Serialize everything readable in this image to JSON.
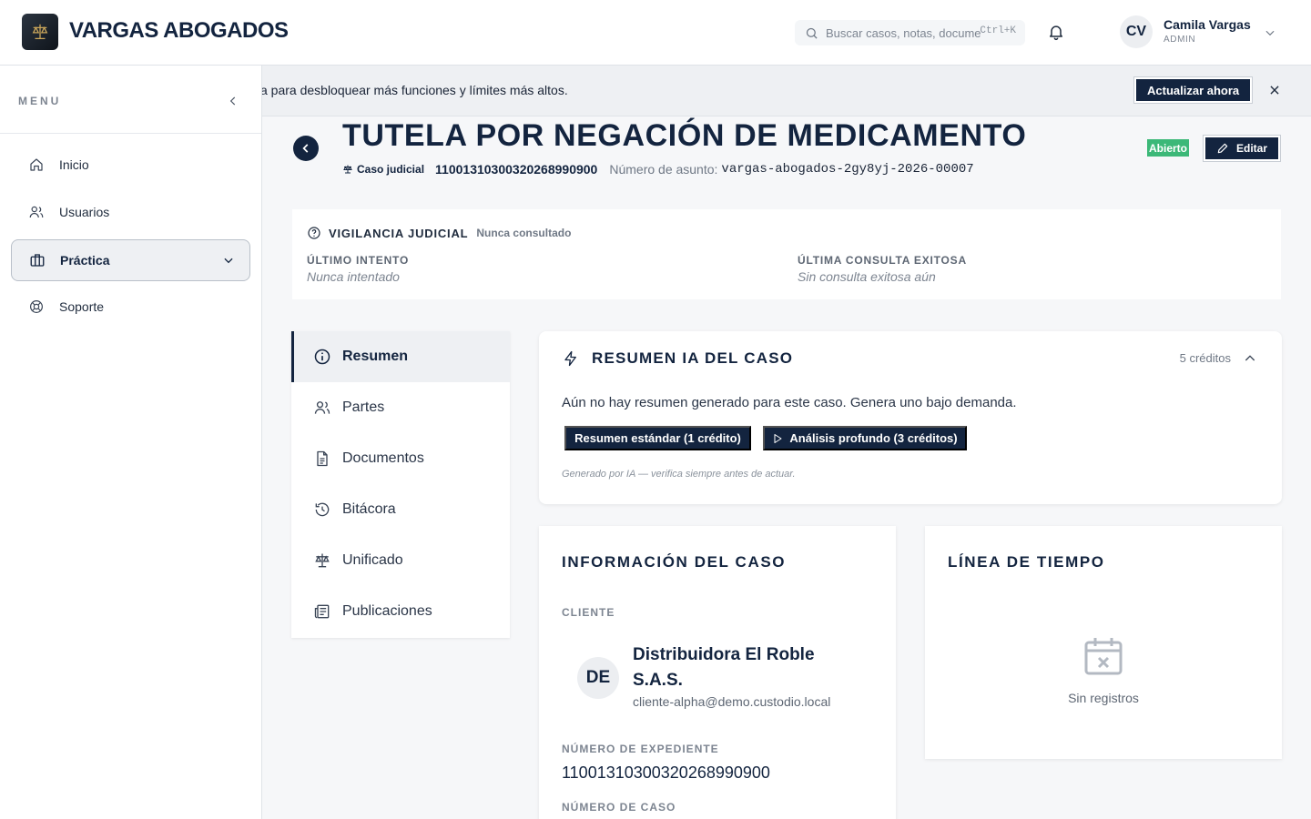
{
  "header": {
    "brand": "VARGAS ABOGADOS",
    "search_placeholder": "Buscar casos, notas, documentos",
    "search_shortcut": "Ctrl+K",
    "user": {
      "initials": "CV",
      "name": "Camila Vargas",
      "role": "ADMIN"
    }
  },
  "sidebar": {
    "menu_label": "MENU",
    "items": [
      {
        "label": "Inicio",
        "icon": "home-icon"
      },
      {
        "label": "Usuarios",
        "icon": "users-icon"
      },
      {
        "label": "Práctica",
        "icon": "briefcase-icon",
        "active": true
      },
      {
        "label": "Soporte",
        "icon": "lifebuoy-icon"
      }
    ]
  },
  "banner": {
    "text": "a para desbloquear más funciones y límites más altos.",
    "button": "Actualizar ahora"
  },
  "case": {
    "title": "TUTELA POR NEGACIÓN DE MEDICAMENTO",
    "type": "Caso judicial",
    "number": "11001310300320268990900",
    "matter_label": "Número de asunto:",
    "matter_code": "vargas-abogados-2gy8yj-2026-00007",
    "status": "Abierto",
    "edit_label": "Editar"
  },
  "vigilancia": {
    "title": "VIGILANCIA JUDICIAL",
    "status": "Nunca consultado",
    "last_attempt_label": "ÚLTIMO INTENTO",
    "last_attempt_value": "Nunca intentado",
    "last_success_label": "ÚLTIMA CONSULTA EXITOSA",
    "last_success_value": "Sin consulta exitosa aún"
  },
  "tabs": [
    {
      "label": "Resumen",
      "icon": "info-icon",
      "active": true
    },
    {
      "label": "Partes",
      "icon": "users-icon"
    },
    {
      "label": "Documentos",
      "icon": "document-icon"
    },
    {
      "label": "Bitácora",
      "icon": "history-icon"
    },
    {
      "label": "Unificado",
      "icon": "scale-icon"
    },
    {
      "label": "Publicaciones",
      "icon": "newspaper-icon"
    }
  ],
  "ai_summary": {
    "title": "RESUMEN IA DEL CASO",
    "credits": "5 créditos",
    "empty_text": "Aún no hay resumen generado para este caso. Genera uno bajo demanda.",
    "standard_button": "Resumen estándar (1 crédito)",
    "deep_button": "Análisis profundo (3 créditos)",
    "disclaimer": "Generado por IA — verifica siempre antes de actuar."
  },
  "case_info": {
    "title": "INFORMACIÓN DEL CASO",
    "client_label": "CLIENTE",
    "client_initials": "DE",
    "client_name": "Distribuidora El Roble S.A.S.",
    "client_email": "cliente-alpha@demo.custodio.local",
    "file_label": "NÚMERO DE EXPEDIENTE",
    "file_value": "11001310300320268990900",
    "case_number_label": "NÚMERO DE CASO"
  },
  "timeline": {
    "title": "LÍNEA DE TIEMPO",
    "empty": "Sin registros"
  },
  "colors": {
    "primary": "#13243f",
    "success": "#3cb878",
    "muted": "#7d8591"
  }
}
